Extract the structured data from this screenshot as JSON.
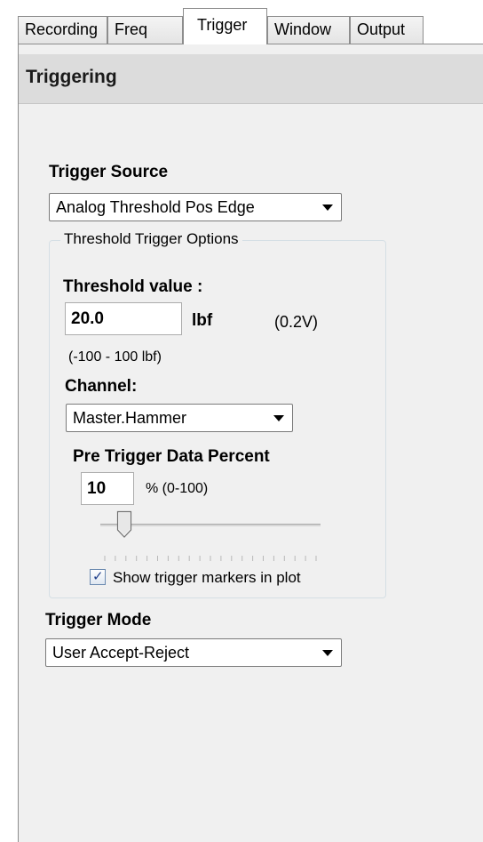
{
  "tabs": [
    {
      "label": "Recording"
    },
    {
      "label": "Freq"
    },
    {
      "label": "Trigger"
    },
    {
      "label": "Window"
    },
    {
      "label": "Output"
    }
  ],
  "active_tab": "Trigger",
  "panel": {
    "title": "Triggering"
  },
  "trigger_source": {
    "label": "Trigger Source",
    "selected": "Analog Threshold Pos Edge"
  },
  "threshold_group": {
    "legend": "Threshold Trigger Options",
    "threshold_label": "Threshold value :",
    "threshold_value": "20.0",
    "threshold_unit": "lbf",
    "threshold_voltage": "(0.2V)",
    "threshold_range": "(-100 - 100 lbf)",
    "channel_label": "Channel:",
    "channel_selected": "Master.Hammer",
    "pre_trigger_label": "Pre Trigger Data Percent",
    "pre_trigger_value": "10",
    "pre_trigger_range": "% (0-100)",
    "pre_trigger_slider_fraction": 0.1,
    "show_markers_label": "Show trigger markers in plot",
    "show_markers_checked": true
  },
  "trigger_mode": {
    "label": "Trigger Mode",
    "selected": "User Accept-Reject"
  },
  "icons": {
    "dropdown": "chevron-down-icon",
    "check": "check-icon"
  },
  "colors": {
    "header_bg": "#dcdcdc",
    "panel_bg": "#f0f0f0",
    "checkbox_tick": "#1f3e8a"
  }
}
